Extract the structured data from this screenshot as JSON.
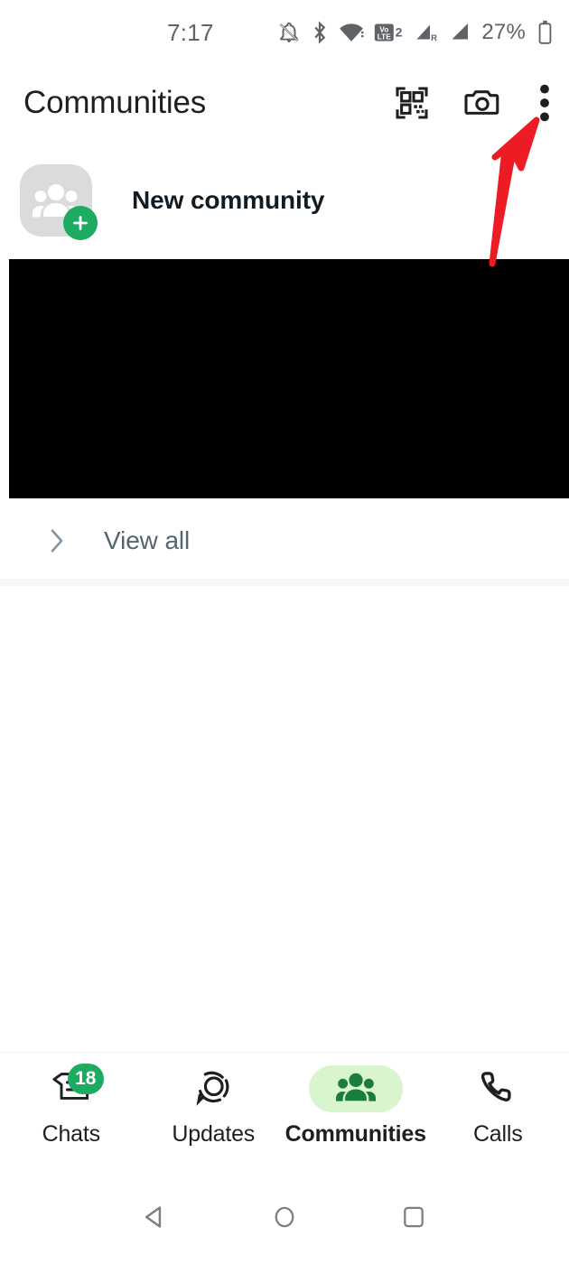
{
  "status_bar": {
    "time": "7:17",
    "battery_percent": "27%",
    "icons": [
      "notifications-silenced-icon",
      "bluetooth-icon",
      "wifi-icon",
      "volte2-icon",
      "signal-roaming-icon",
      "signal-icon",
      "battery-icon"
    ]
  },
  "header": {
    "title": "Communities",
    "actions": [
      {
        "name": "qr-code-icon",
        "label": "QR code"
      },
      {
        "name": "camera-icon",
        "label": "Camera"
      },
      {
        "name": "overflow-menu-icon",
        "label": "More options"
      }
    ]
  },
  "main": {
    "new_community": {
      "label": "New community",
      "avatar_icon": "community-group-icon",
      "badge_icon": "plus-icon"
    },
    "redacted_block": {
      "label": "redacted-content"
    },
    "view_all": {
      "label": "View all",
      "icon": "chevron-right-icon"
    }
  },
  "bottom_nav": {
    "items": [
      {
        "label": "Chats",
        "icon": "chats-icon",
        "badge": "18",
        "active": false
      },
      {
        "label": "Updates",
        "icon": "updates-icon",
        "badge": "",
        "active": false
      },
      {
        "label": "Communities",
        "icon": "communities-icon",
        "badge": "",
        "active": true
      },
      {
        "label": "Calls",
        "icon": "calls-icon",
        "badge": "",
        "active": false
      }
    ]
  },
  "system_nav": {
    "back": "back-icon",
    "home": "home-icon",
    "recents": "recents-icon"
  },
  "annotation": {
    "arrow_color": "#ED1C24",
    "points_to": "overflow-menu-icon"
  },
  "colors": {
    "accent_green": "#1daa61",
    "active_pill": "#d8f5cd",
    "active_icon": "#1a7d3f",
    "text_primary": "#111b21",
    "text_secondary": "#54656f",
    "annotation_red": "#ED1C24"
  }
}
